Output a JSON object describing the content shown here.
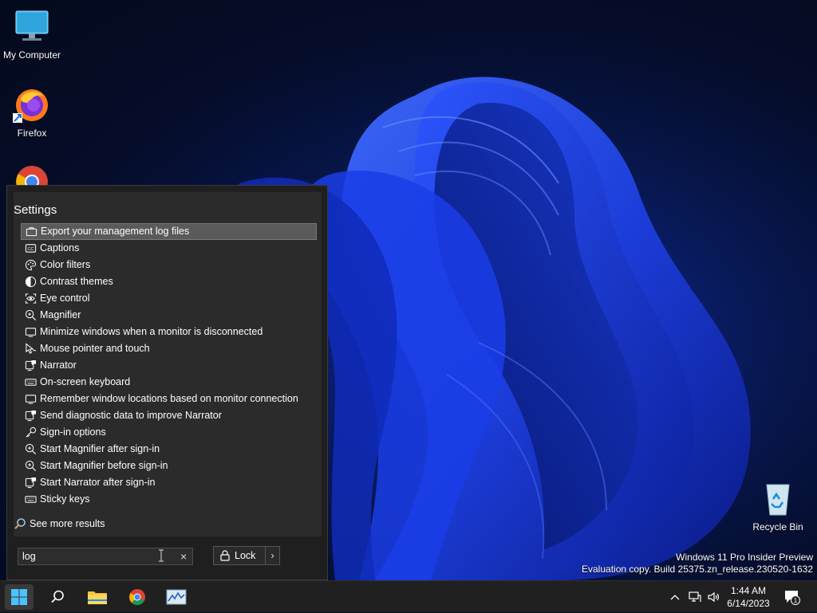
{
  "desktop": {
    "icons": [
      {
        "label": "My Computer"
      },
      {
        "label": "Firefox"
      },
      {
        "label": "Recycle Bin"
      }
    ],
    "watermark": {
      "line1": "Windows 11 Pro Insider Preview",
      "line2": "Evaluation copy. Build 25375.zn_release.230520-1632"
    }
  },
  "search_menu": {
    "header": "Settings",
    "results": [
      {
        "label": "Export your management log files",
        "icon": "briefcase-icon",
        "selected": true
      },
      {
        "label": "Captions",
        "icon": "cc-icon"
      },
      {
        "label": "Color filters",
        "icon": "palette-icon"
      },
      {
        "label": "Contrast themes",
        "icon": "contrast-icon"
      },
      {
        "label": "Eye control",
        "icon": "eye-control-icon"
      },
      {
        "label": "Magnifier",
        "icon": "magnifier-icon"
      },
      {
        "label": "Minimize windows when a monitor is disconnected",
        "icon": "monitor-icon"
      },
      {
        "label": "Mouse pointer and touch",
        "icon": "pointer-icon"
      },
      {
        "label": "Narrator",
        "icon": "narrator-icon"
      },
      {
        "label": "On-screen keyboard",
        "icon": "keyboard-icon"
      },
      {
        "label": "Remember window locations based on monitor connection",
        "icon": "monitor-icon"
      },
      {
        "label": "Send diagnostic data to improve Narrator",
        "icon": "narrator-icon"
      },
      {
        "label": "Sign-in options",
        "icon": "key-icon"
      },
      {
        "label": "Start Magnifier after sign-in",
        "icon": "magnifier-icon"
      },
      {
        "label": "Start Magnifier before sign-in",
        "icon": "magnifier-icon"
      },
      {
        "label": "Start Narrator after sign-in",
        "icon": "narrator-icon"
      },
      {
        "label": "Sticky keys",
        "icon": "keyboard-icon"
      }
    ],
    "see_more": "See more results",
    "search_value": "log",
    "clear_glyph": "×",
    "lock_label": "Lock",
    "lock_arrow": "›"
  },
  "taskbar": {
    "apps": [
      "start-icon",
      "search-icon",
      "file-explorer-icon",
      "chrome-icon",
      "performance-monitor-icon"
    ],
    "clock_time": "1:44 AM",
    "clock_date": "6/14/2023",
    "notification_count": "1"
  }
}
